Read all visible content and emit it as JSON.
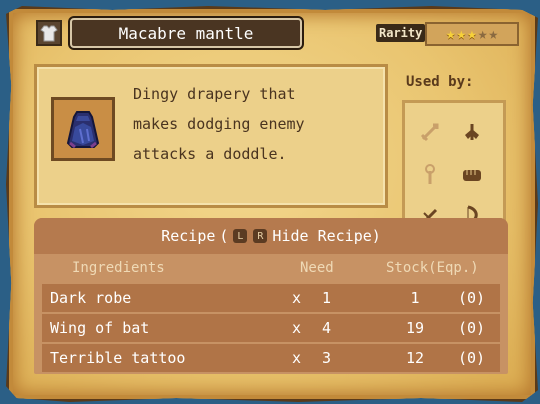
{
  "item": {
    "name": "Macabre mantle",
    "description": "Dingy drapery that\nmakes dodging enemy\nattacks a doddle.",
    "icon": "cloak-icon",
    "category_icon": "armor-icon"
  },
  "rarity": {
    "label": "Rarity",
    "stars_filled": 3,
    "stars_total": 5
  },
  "used_by": {
    "label": "Used by:",
    "icons": [
      "sword-icon",
      "axe-icon",
      "staff-icon",
      "fist-icon",
      "dagger-icon",
      "bow-icon"
    ]
  },
  "recipe": {
    "title": "Recipe",
    "paren_open": "(",
    "btn_l": "L",
    "btn_r": "R",
    "toggle_label": "Hide Recipe)",
    "columns": {
      "ingredients": "Ingredients",
      "need": "Need",
      "stock": "Stock(Eqp.)"
    },
    "rows": [
      {
        "name": "Dark robe",
        "x": "x",
        "need": "1",
        "stock": "1",
        "eqp": "(0)"
      },
      {
        "name": "Wing of bat",
        "x": "x",
        "need": "4",
        "stock": "19",
        "eqp": "(0)"
      },
      {
        "name": "Terrible tattoo",
        "x": "x",
        "need": "3",
        "stock": "12",
        "eqp": "(0)"
      }
    ]
  }
}
